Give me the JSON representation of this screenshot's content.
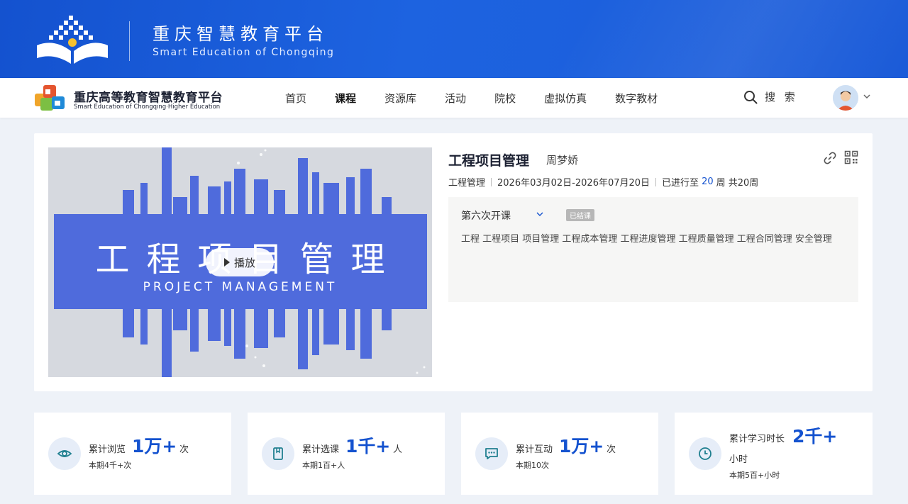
{
  "banner": {
    "title": "重庆智慧教育平台",
    "subtitle": "Smart Education of Chongqing"
  },
  "nav": {
    "logo_title": "重庆高等教育智慧教育平台",
    "logo_subtitle": "Smart Education of Chongqing·Higher Education",
    "items": [
      "首页",
      "课程",
      "资源库",
      "活动",
      "院校",
      "虚拟仿真",
      "数字教材"
    ],
    "active_item": "课程",
    "search_label": "搜 索"
  },
  "course": {
    "cover_title": "工程项目管理",
    "cover_subtitle": "PROJECT MANAGEMENT",
    "play_label": "播放",
    "title": "工程项目管理",
    "teacher": "周梦娇",
    "category": "工程管理",
    "date_range": "2026年03月02日-2026年07月20日",
    "progress_prefix": "已进行至",
    "progress_week": "20",
    "progress_suffix": "周 共20周",
    "session": {
      "name": "第六次开课",
      "status_badge": "已结课",
      "tags": "工程 工程项目 项目管理 工程成本管理 工程进度管理 工程质量管理 工程合同管理 安全管理"
    }
  },
  "stats": [
    {
      "icon": "eye-icon",
      "label": "累计浏览",
      "value": "1万+",
      "unit": "次",
      "sub": "本期4千+次"
    },
    {
      "icon": "book-icon",
      "label": "累计选课",
      "value": "1千+",
      "unit": "人",
      "sub": "本期1百+人"
    },
    {
      "icon": "chat-icon",
      "label": "累计互动",
      "value": "1万+",
      "unit": "次",
      "sub": "本期10次"
    },
    {
      "icon": "clock-icon",
      "label": "累计学习时长",
      "value": "2千+",
      "unit": "小时",
      "sub": "本期5百+小时"
    }
  ],
  "colors": {
    "brand_blue": "#1452cf",
    "cover_band": "#4f6bdc",
    "page_bg": "#eef2f8"
  }
}
